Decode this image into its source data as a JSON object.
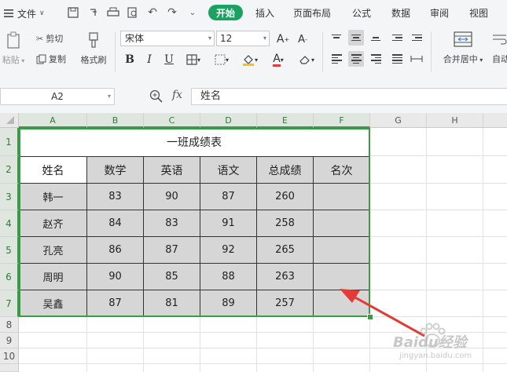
{
  "menu": {
    "file": "文件",
    "tabs": [
      "插入",
      "页面布局",
      "公式",
      "数据",
      "审阅",
      "视图"
    ],
    "active_tab": "开始"
  },
  "ribbon": {
    "paste": "粘贴",
    "cut": "剪切",
    "copy": "复制",
    "format_painter": "格式刷",
    "font_name": "宋体",
    "font_size": "12",
    "merge_center": "合并居中",
    "auto_wrap": "自动"
  },
  "formula_bar": {
    "name_box": "A2",
    "fx": "fx",
    "content": "姓名"
  },
  "columns": [
    "A",
    "B",
    "C",
    "D",
    "E",
    "F",
    "G",
    "H"
  ],
  "rows": [
    "1",
    "2",
    "3",
    "4",
    "5",
    "6",
    "7",
    "8",
    "9",
    "10"
  ],
  "sheet": {
    "title": "一班成绩表",
    "headers": [
      "姓名",
      "数学",
      "英语",
      "语文",
      "总成绩",
      "名次"
    ],
    "records": [
      [
        "韩一",
        "83",
        "90",
        "87",
        "260",
        ""
      ],
      [
        "赵齐",
        "84",
        "83",
        "91",
        "258",
        ""
      ],
      [
        "孔亮",
        "86",
        "87",
        "92",
        "265",
        ""
      ],
      [
        "周明",
        "90",
        "85",
        "88",
        "263",
        ""
      ],
      [
        "吴鑫",
        "87",
        "81",
        "89",
        "257",
        ""
      ]
    ]
  },
  "watermark": "Baidu经验",
  "watermark_url": "jingyan.baidu.com",
  "colors": {
    "accent": "#1aa260",
    "selection_border": "#3a9b46",
    "selection_fill": "#d6d6d6",
    "arrow": "#e53935"
  }
}
